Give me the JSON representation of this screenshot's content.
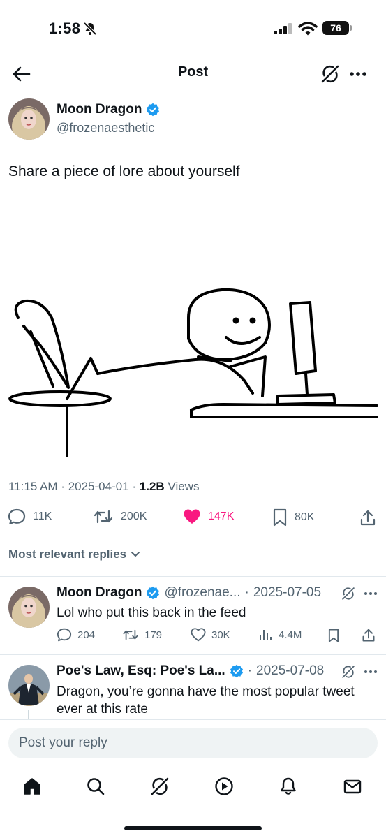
{
  "status_bar": {
    "time": "1:58",
    "battery": "76"
  },
  "header": {
    "title": "Post"
  },
  "tweet": {
    "author_name": "Moon Dragon",
    "author_handle": "@frozenaesthetic",
    "text": "Share a piece of lore about yourself",
    "time": "11:15 AM",
    "date": "2025-04-01",
    "views_count": "1.2B",
    "views_label": "Views",
    "replies": "11K",
    "reposts": "200K",
    "likes": "147K",
    "bookmarks": "80K"
  },
  "replies_section": {
    "sort_label": "Most relevant replies"
  },
  "replies": [
    {
      "name": "Moon Dragon",
      "handle": "@frozenae...",
      "date": "2025-07-05",
      "text": "Lol who put this back in the feed",
      "replies": "204",
      "reposts": "179",
      "likes": "30K",
      "views": "4.4M"
    },
    {
      "name": "Poe's Law, Esq: Poe's La...",
      "date": "2025-07-08",
      "text_line1": "Dragon, you’re gonna have the most popular tweet",
      "text_line2": "ever at this rate"
    }
  ],
  "composer": {
    "placeholder": "Post your reply"
  },
  "colors": {
    "like": "#f91880",
    "verified": "#1d9bf0",
    "muted": "#536471"
  }
}
